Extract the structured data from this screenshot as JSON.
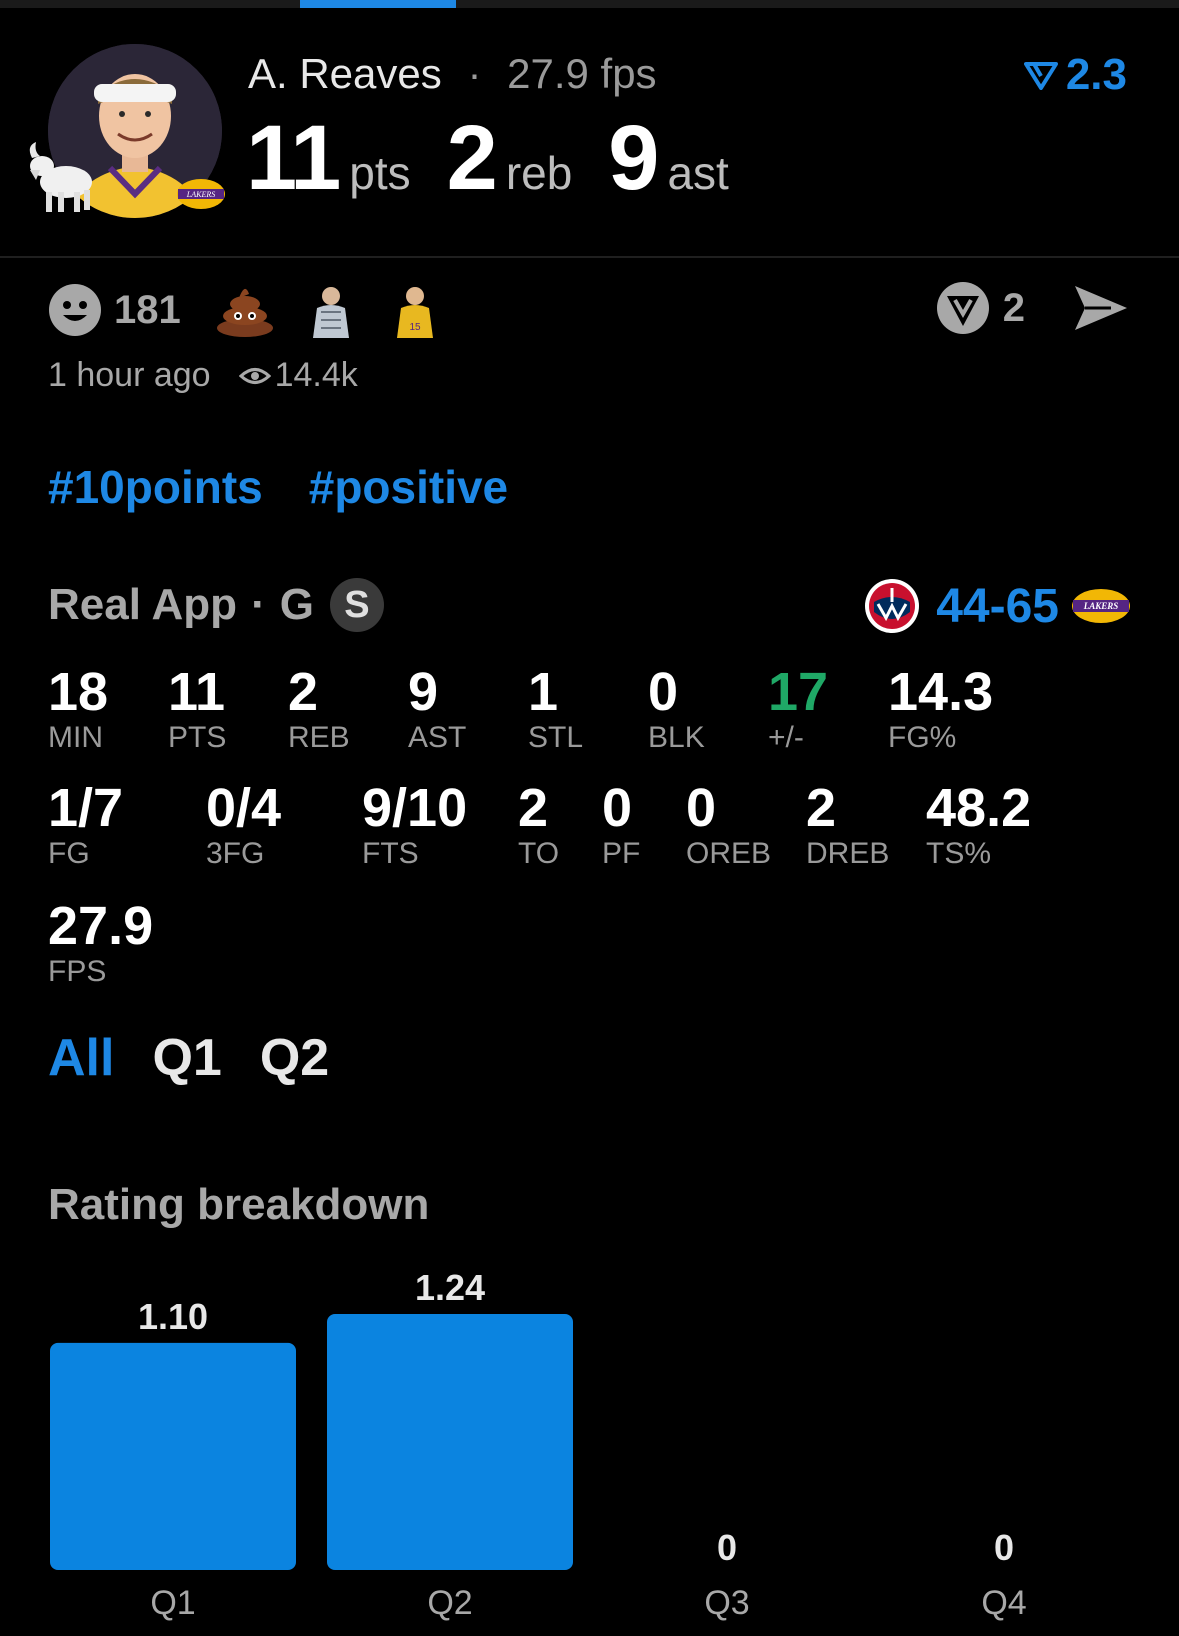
{
  "header": {
    "player_name": "A. Reaves",
    "separator": "·",
    "fps_text": "27.9 fps",
    "rating": "2.3",
    "stats": [
      {
        "value": "11",
        "unit": "pts"
      },
      {
        "value": "2",
        "unit": "reb"
      },
      {
        "value": "9",
        "unit": "ast"
      }
    ]
  },
  "reactions": {
    "count": "181",
    "time_ago": "1 hour ago",
    "views": "14.4k",
    "v_count": "2",
    "icons": [
      "smile-icon",
      "poop-emoji",
      "player-sticker",
      "player-sticker"
    ]
  },
  "tags": [
    "#10points",
    "#positive"
  ],
  "game": {
    "source": "Real App",
    "separator": "·",
    "position": "G",
    "badge": "S",
    "score": "44-65"
  },
  "stats_row1": [
    {
      "value": "18",
      "label": "MIN"
    },
    {
      "value": "11",
      "label": "PTS"
    },
    {
      "value": "2",
      "label": "REB"
    },
    {
      "value": "9",
      "label": "AST"
    },
    {
      "value": "1",
      "label": "STL"
    },
    {
      "value": "0",
      "label": "BLK"
    },
    {
      "value": "17",
      "label": "+/-"
    },
    {
      "value": "14.3",
      "label": "FG%"
    }
  ],
  "stats_row2": [
    {
      "value": "1/7",
      "label": "FG"
    },
    {
      "value": "0/4",
      "label": "3FG"
    },
    {
      "value": "9/10",
      "label": "FTS"
    },
    {
      "value": "2",
      "label": "TO"
    },
    {
      "value": "0",
      "label": "PF"
    },
    {
      "value": "0",
      "label": "OREB"
    },
    {
      "value": "2",
      "label": "DREB"
    },
    {
      "value": "48.2",
      "label": "TS%"
    }
  ],
  "stats_row3": [
    {
      "value": "27.9",
      "label": "FPS"
    }
  ],
  "period_tabs": [
    "All",
    "Q1",
    "Q2"
  ],
  "rating_breakdown_title": "Rating breakdown",
  "colors": {
    "accent": "#1e88e5",
    "positive": "#1fa866",
    "bar": "#0b84e0"
  },
  "chart_data": {
    "type": "bar",
    "categories": [
      "Q1",
      "Q2",
      "Q3",
      "Q4"
    ],
    "values": [
      1.1,
      1.24,
      0,
      0
    ],
    "value_labels": [
      "1.10",
      "1.24",
      "0",
      "0"
    ],
    "title": "Rating breakdown"
  }
}
